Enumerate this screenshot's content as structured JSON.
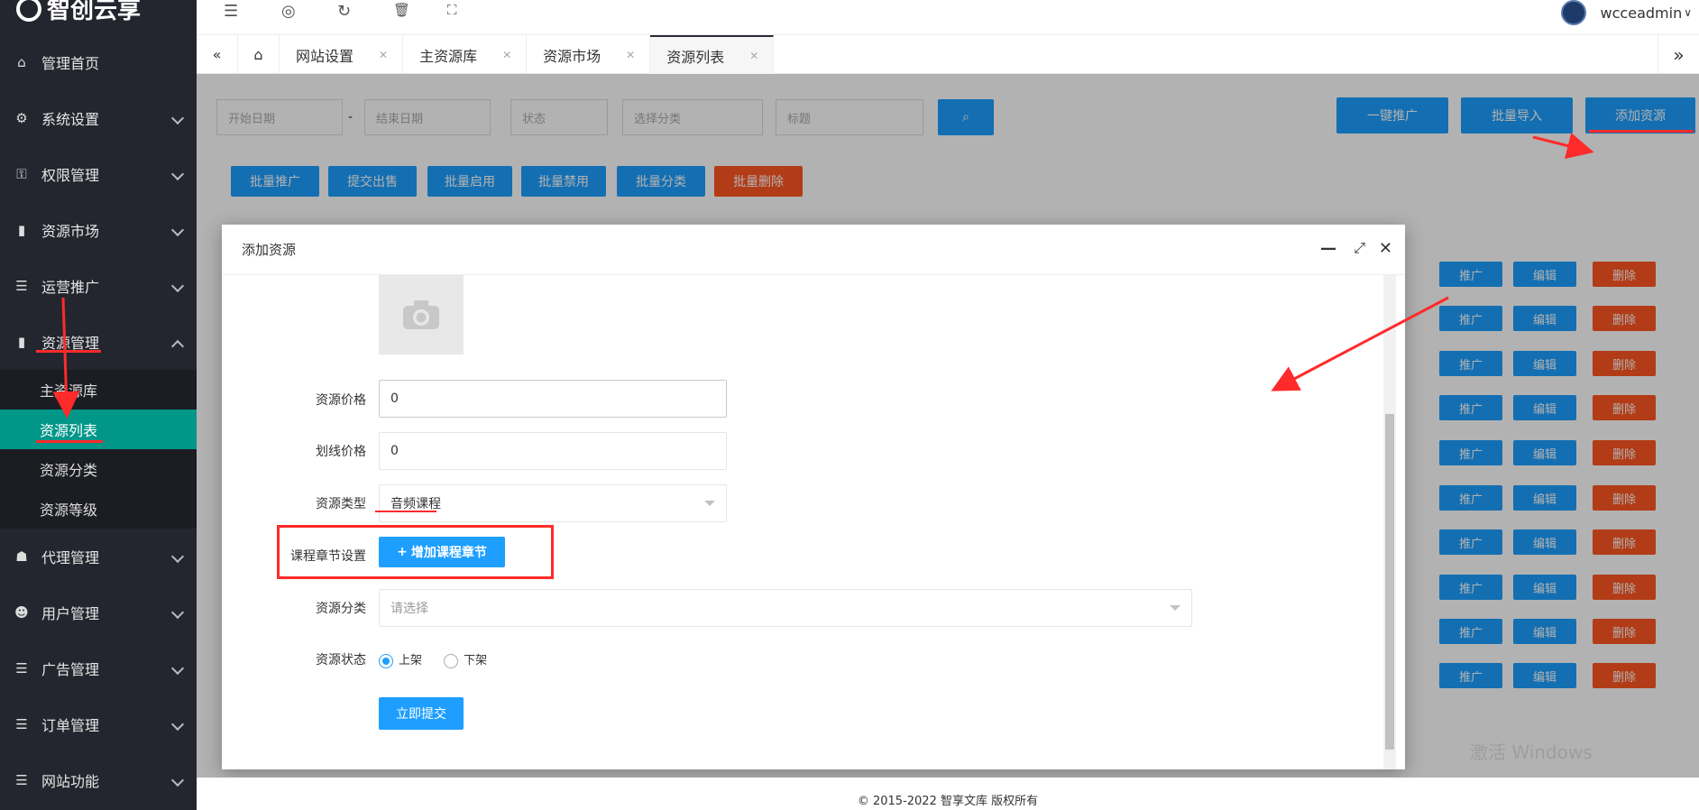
{
  "brand": {
    "name": "智创云享"
  },
  "sidebar": {
    "items": [
      {
        "label": "管理首页",
        "icon": "home-icon"
      },
      {
        "label": "系统设置",
        "icon": "gear-icon"
      },
      {
        "label": "权限管理",
        "icon": "key-icon"
      },
      {
        "label": "资源市场",
        "icon": "book-icon"
      },
      {
        "label": "运营推广",
        "icon": "list-icon"
      },
      {
        "label": "资源管理",
        "icon": "book-icon"
      },
      {
        "label": "代理管理",
        "icon": "user-icon"
      },
      {
        "label": "用户管理",
        "icon": "user-icon"
      },
      {
        "label": "广告管理",
        "icon": "list-icon"
      },
      {
        "label": "订单管理",
        "icon": "list-icon"
      },
      {
        "label": "网站功能",
        "icon": "list-icon"
      }
    ],
    "sub_items": [
      "主资源库",
      "资源列表",
      "资源分类",
      "资源等级"
    ]
  },
  "topbar": {
    "username": "wcceadmin"
  },
  "tabs": [
    {
      "label": "网站设置"
    },
    {
      "label": "主资源库"
    },
    {
      "label": "资源市场"
    },
    {
      "label": "资源列表"
    }
  ],
  "filters": {
    "start_date": "开始日期",
    "dash": "-",
    "end_date": "结束日期",
    "status": "状态",
    "category": "选择分类",
    "title": "标题"
  },
  "actions": {
    "promote_one": "一键推广",
    "batch_import": "批量导入",
    "add_resource": "添加资源"
  },
  "batch": {
    "promote": "批量推广",
    "submit_sale": "提交出售",
    "enable": "批量启用",
    "disable": "批量禁用",
    "classify": "批量分类",
    "delete": "批量删除"
  },
  "row_actions": {
    "promote": "推广",
    "edit": "编辑",
    "delete": "删除"
  },
  "modal": {
    "title": "添加资源",
    "price_label": "资源价格",
    "price_value": "0",
    "strike_label": "划线价格",
    "strike_value": "0",
    "type_label": "资源类型",
    "type_value": "音频课程",
    "chapter_label": "课程章节设置",
    "chapter_button": "增加课程章节",
    "category_label": "资源分类",
    "category_placeholder": "请选择",
    "status_label": "资源状态",
    "status_on": "上架",
    "status_off": "下架",
    "submit": "立即提交"
  },
  "footer": {
    "text": "© 2015-2022 智享文库 版权所有"
  },
  "watermark": {
    "text": "激活 Windows"
  },
  "colors": {
    "sidebar": "#23262e",
    "active": "#009688",
    "primary": "#1e9fff",
    "danger": "#ff5722",
    "annotation": "#ff2a2a"
  }
}
